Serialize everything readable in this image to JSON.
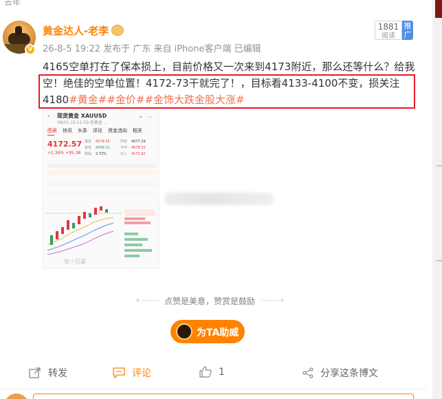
{
  "top_fragment": "去年",
  "user": {
    "name": "黄金达人-老李",
    "badge": "V",
    "meta": "26-8-5 19:22  发布于 广东  来自 iPhone客户端  已编辑"
  },
  "read_count": {
    "number": "1881",
    "label": "阅读"
  },
  "promote": {
    "label": "推广"
  },
  "post": {
    "text_before": "4165空单打在了保本损上，目前价格又一次来到4173附近，那么还等什么？给我空！绝佳的空单位置！4172-73干就完了！，目标看4133-4100不变，损关注4180",
    "tags": [
      "#黄金#",
      "#金价#",
      "#金饰大跌金股大涨#"
    ]
  },
  "thumbnail": {
    "title": "现货黄金 XAUUSD",
    "subtitle": "08/05 19:21:59  伦敦金 ...",
    "tabs": [
      "图表",
      "快讯",
      "头条",
      "评论",
      "资金流向",
      "相关"
    ],
    "price": "4172.57",
    "change": "+2.36%  +95.38",
    "stats": [
      [
        "最高",
        "4179.55",
        "昨收",
        "4077.19"
      ],
      [
        "最低",
        "4068.52",
        "今开",
        "4078.31"
      ],
      [
        "振幅",
        "2.72%",
        "买入",
        "4172.62"
      ]
    ],
    "watermark": "黄十百赢"
  },
  "encourage": "点赞是美意，赞赏是鼓励",
  "tip_button": "为TA助威",
  "actions": {
    "repost": "转发",
    "comment": "评论",
    "like": "1",
    "share": "分享这条博文"
  },
  "colors": {
    "accent": "#ff8200",
    "tag": "#eb7350",
    "highlight": "#e21b2a",
    "up": "#e8343b",
    "down": "#2aa15a"
  }
}
